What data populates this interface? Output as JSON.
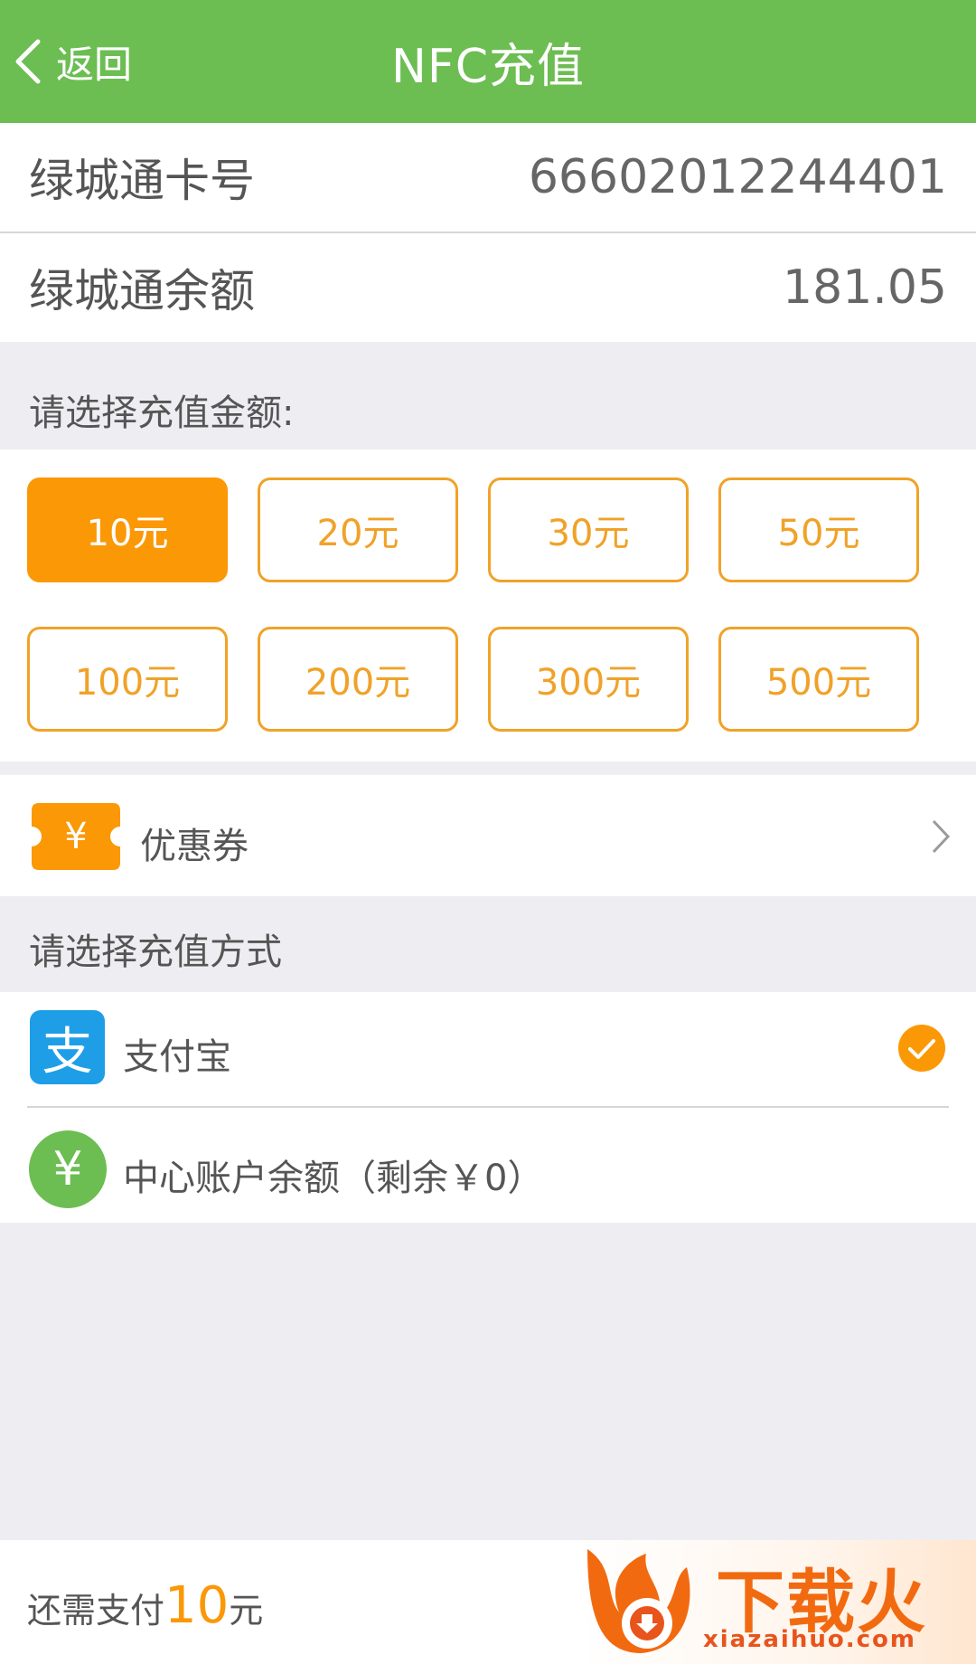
{
  "header": {
    "back_label": "返回",
    "title": "NFC充值"
  },
  "card": {
    "number_label": "绿城通卡号",
    "number_value": "66602012244401",
    "balance_label": "绿城通余额",
    "balance_value": "181.05"
  },
  "amount_section": {
    "label": "请选择充值金额:",
    "options": [
      "10元",
      "20元",
      "30元",
      "50元",
      "100元",
      "200元",
      "300元",
      "500元"
    ],
    "selected": "10元"
  },
  "coupon": {
    "icon_symbol": "¥",
    "label": "优惠券"
  },
  "payment_section": {
    "label": "请选择充值方式",
    "methods": [
      {
        "name": "支付宝",
        "icon": "alipay-icon",
        "icon_symbol": "支",
        "selected": true
      },
      {
        "name": "中心账户余额（剩余￥0）",
        "icon": "yuan-circle-icon",
        "icon_symbol": "¥",
        "selected": false
      }
    ]
  },
  "footer": {
    "pay_prefix": "还需支付",
    "pay_amount": "10",
    "pay_unit": "元",
    "watermark_text": "下载火",
    "watermark_url": "xiazaihuo.com"
  },
  "colors": {
    "header_green": "#6cbd52",
    "accent_orange": "#fb9806",
    "alipay_blue": "#1f9ee8",
    "yuan_green": "#6cbd52"
  }
}
